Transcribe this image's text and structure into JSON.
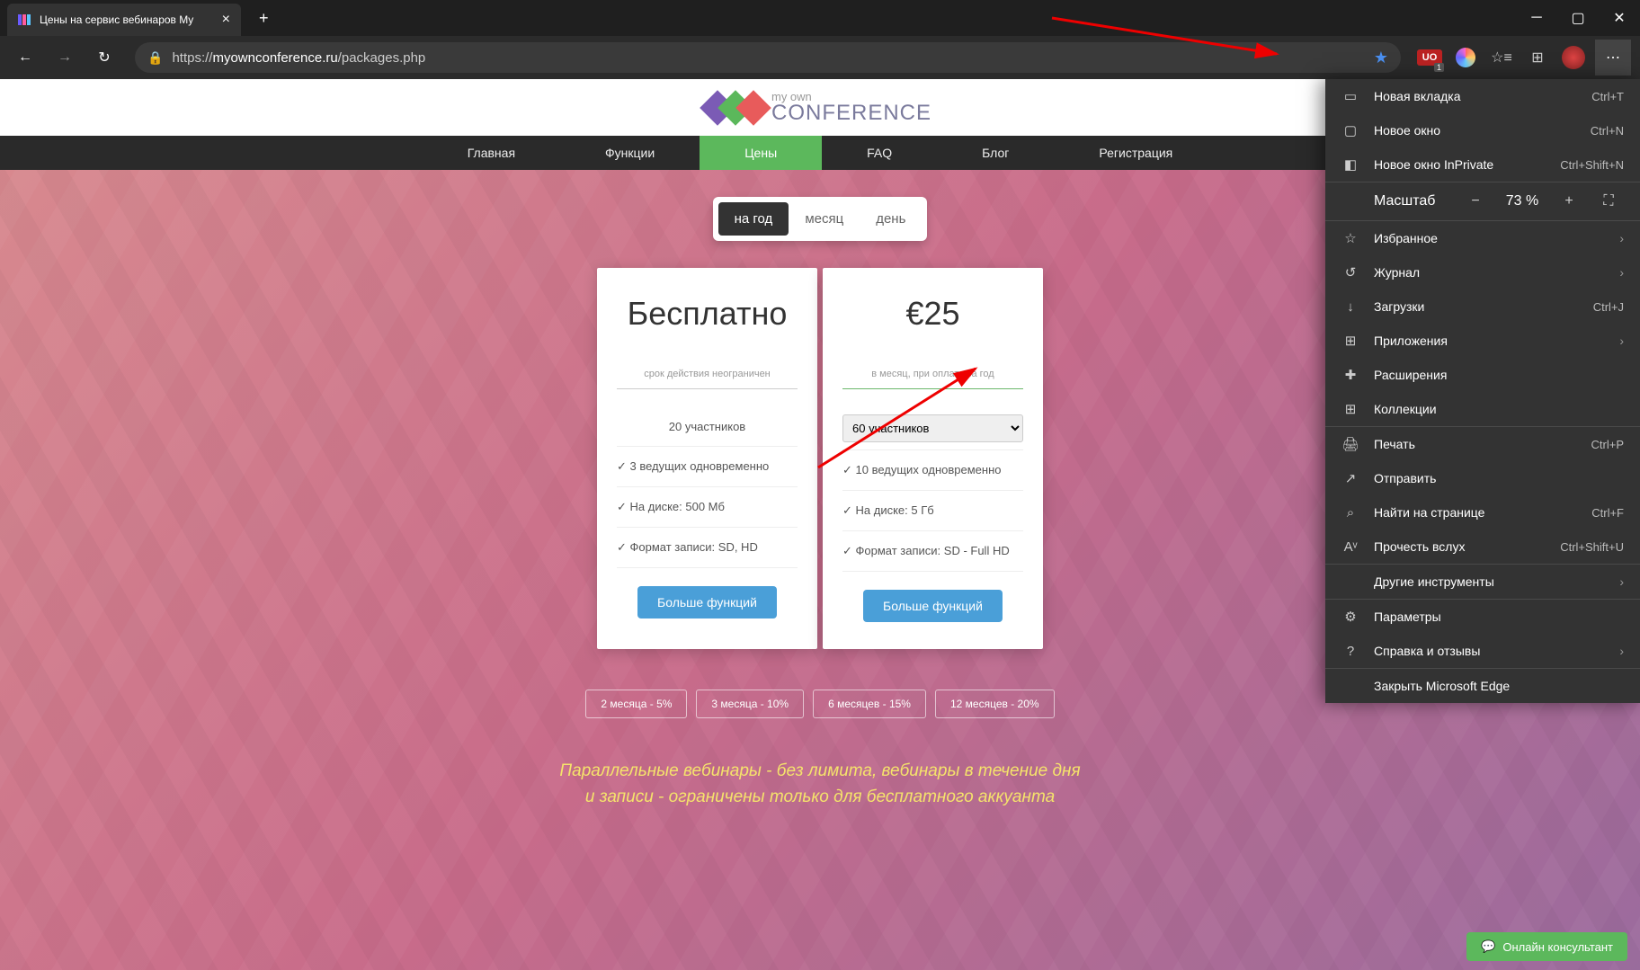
{
  "browser": {
    "tab_title": "Цены на сервис вебинаров My",
    "url_prefix": "https://",
    "url_domain": "myownconference.ru",
    "url_path": "/packages.php"
  },
  "menu": {
    "new_tab": "Новая вкладка",
    "new_tab_sc": "Ctrl+T",
    "new_window": "Новое окно",
    "new_window_sc": "Ctrl+N",
    "new_inprivate": "Новое окно InPrivate",
    "new_inprivate_sc": "Ctrl+Shift+N",
    "zoom_label": "Масштаб",
    "zoom_value": "73 %",
    "favorites": "Избранное",
    "history": "Журнал",
    "downloads": "Загрузки",
    "downloads_sc": "Ctrl+J",
    "apps": "Приложения",
    "extensions": "Расширения",
    "collections": "Коллекции",
    "print": "Печать",
    "print_sc": "Ctrl+P",
    "share": "Отправить",
    "find": "Найти на странице",
    "find_sc": "Ctrl+F",
    "read_aloud": "Прочесть вслух",
    "read_aloud_sc": "Ctrl+Shift+U",
    "more_tools": "Другие инструменты",
    "settings": "Параметры",
    "help": "Справка и отзывы",
    "close": "Закрыть Microsoft Edge"
  },
  "site": {
    "logo_small": "my own",
    "logo_big": "CONFERENCE",
    "nav": {
      "home": "Главная",
      "features": "Функции",
      "prices": "Цены",
      "faq": "FAQ",
      "blog": "Блог",
      "register": "Регистрация"
    },
    "period": {
      "year": "на год",
      "month": "месяц",
      "day": "день"
    },
    "card_free": {
      "price": "Бесплатно",
      "sub": "срок действия неограничен",
      "participants": "20 участников",
      "presenters": "✓ 3 ведущих одновременно",
      "disk": "✓ На диске: 500 Мб",
      "format": "✓ Формат записи: SD, HD",
      "more": "Больше функций"
    },
    "card_paid": {
      "price": "€25",
      "sub": "в месяц, при оплате за год",
      "participants": "60 участников",
      "presenters": "✓ 10 ведущих одновременно",
      "disk": "✓ На диске: 5 Гб",
      "format": "✓ Формат записи: SD - Full HD",
      "more": "Больше функций"
    },
    "discounts": {
      "d2": "2 месяца - 5%",
      "d3": "3 месяца - 10%",
      "d6": "6 месяцев - 15%",
      "d12": "12 месяцев - 20%"
    },
    "promo_line1": "Параллельные вебинары - без лимита, вебинары в течение дня",
    "promo_line2": "и записи - ограничены только для бесплатного аккуанта"
  },
  "chat": {
    "label": "Онлайн консультант"
  }
}
